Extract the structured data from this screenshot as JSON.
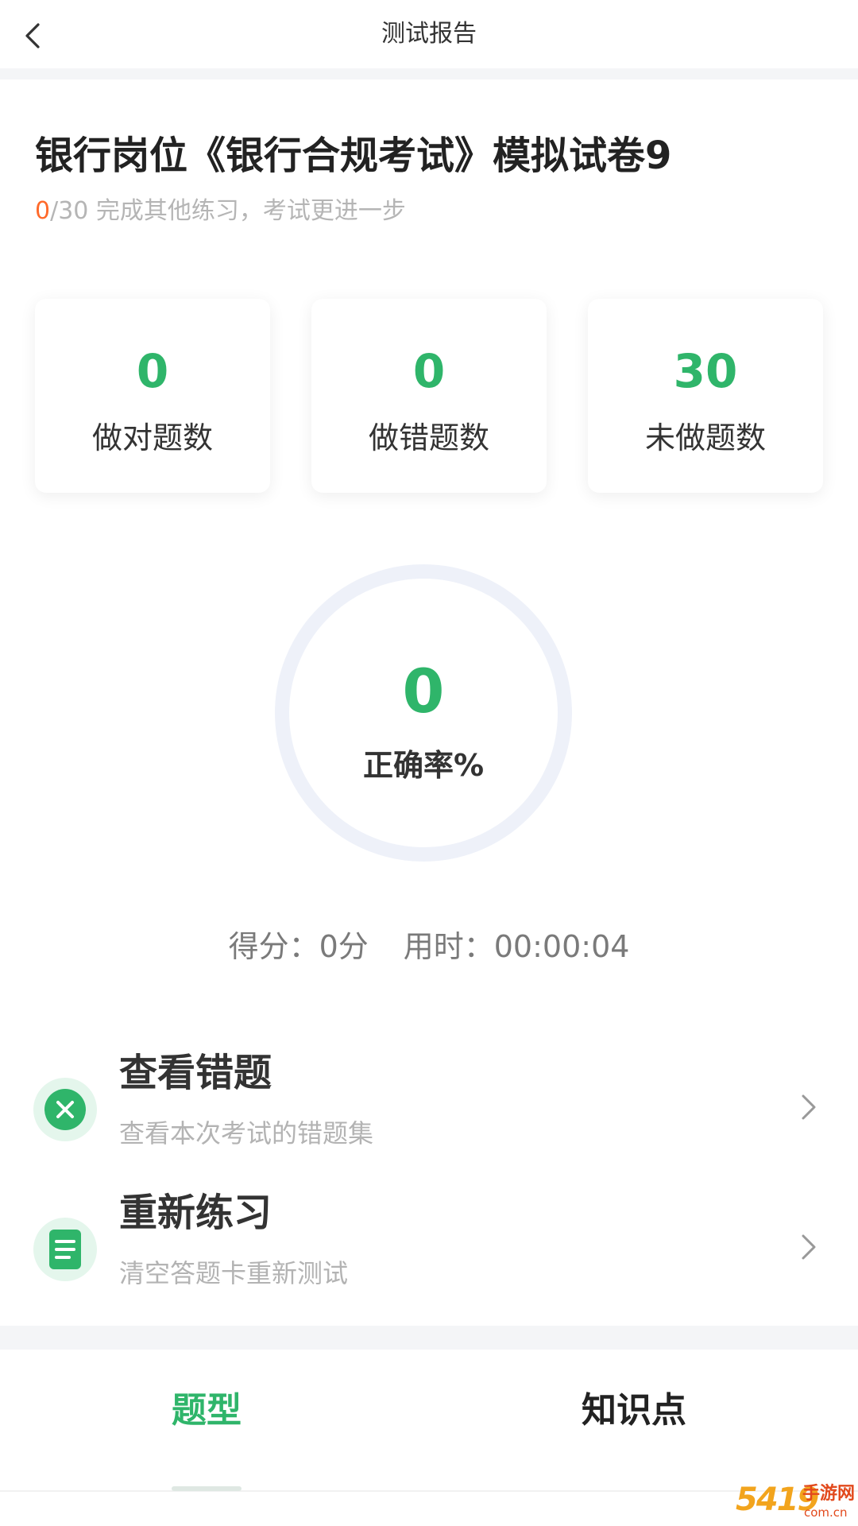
{
  "header": {
    "title": "测试报告",
    "back_icon": "chevron-left-icon"
  },
  "report": {
    "title": "银行岗位《银行合规考试》模拟试卷9",
    "progress_done": "0",
    "progress_rest": "/30 完成其他练习，考试更进一步"
  },
  "stats": [
    {
      "value": "0",
      "label": "做对题数"
    },
    {
      "value": "0",
      "label": "做错题数"
    },
    {
      "value": "30",
      "label": "未做题数"
    }
  ],
  "accuracy": {
    "value": "0",
    "label": "正确率%",
    "fraction": 0
  },
  "summary": {
    "score": "得分：0分",
    "time": "用时：00:00:04"
  },
  "actions": [
    {
      "title": "查看错题",
      "subtitle": "查看本次考试的错题集",
      "icon": "close-circle-icon"
    },
    {
      "title": "重新练习",
      "subtitle": "清空答题卡重新测试",
      "icon": "document-icon"
    }
  ],
  "tabs": [
    {
      "label": "题型",
      "active": true
    },
    {
      "label": "知识点",
      "active": false
    }
  ],
  "watermark": {
    "number": "5419",
    "site_name": "手游网",
    "domain": "com.cn"
  },
  "colors": {
    "accent_green": "#2fb56a",
    "highlight_orange": "#ff6a2b",
    "ring_track": "#eef1f9"
  }
}
